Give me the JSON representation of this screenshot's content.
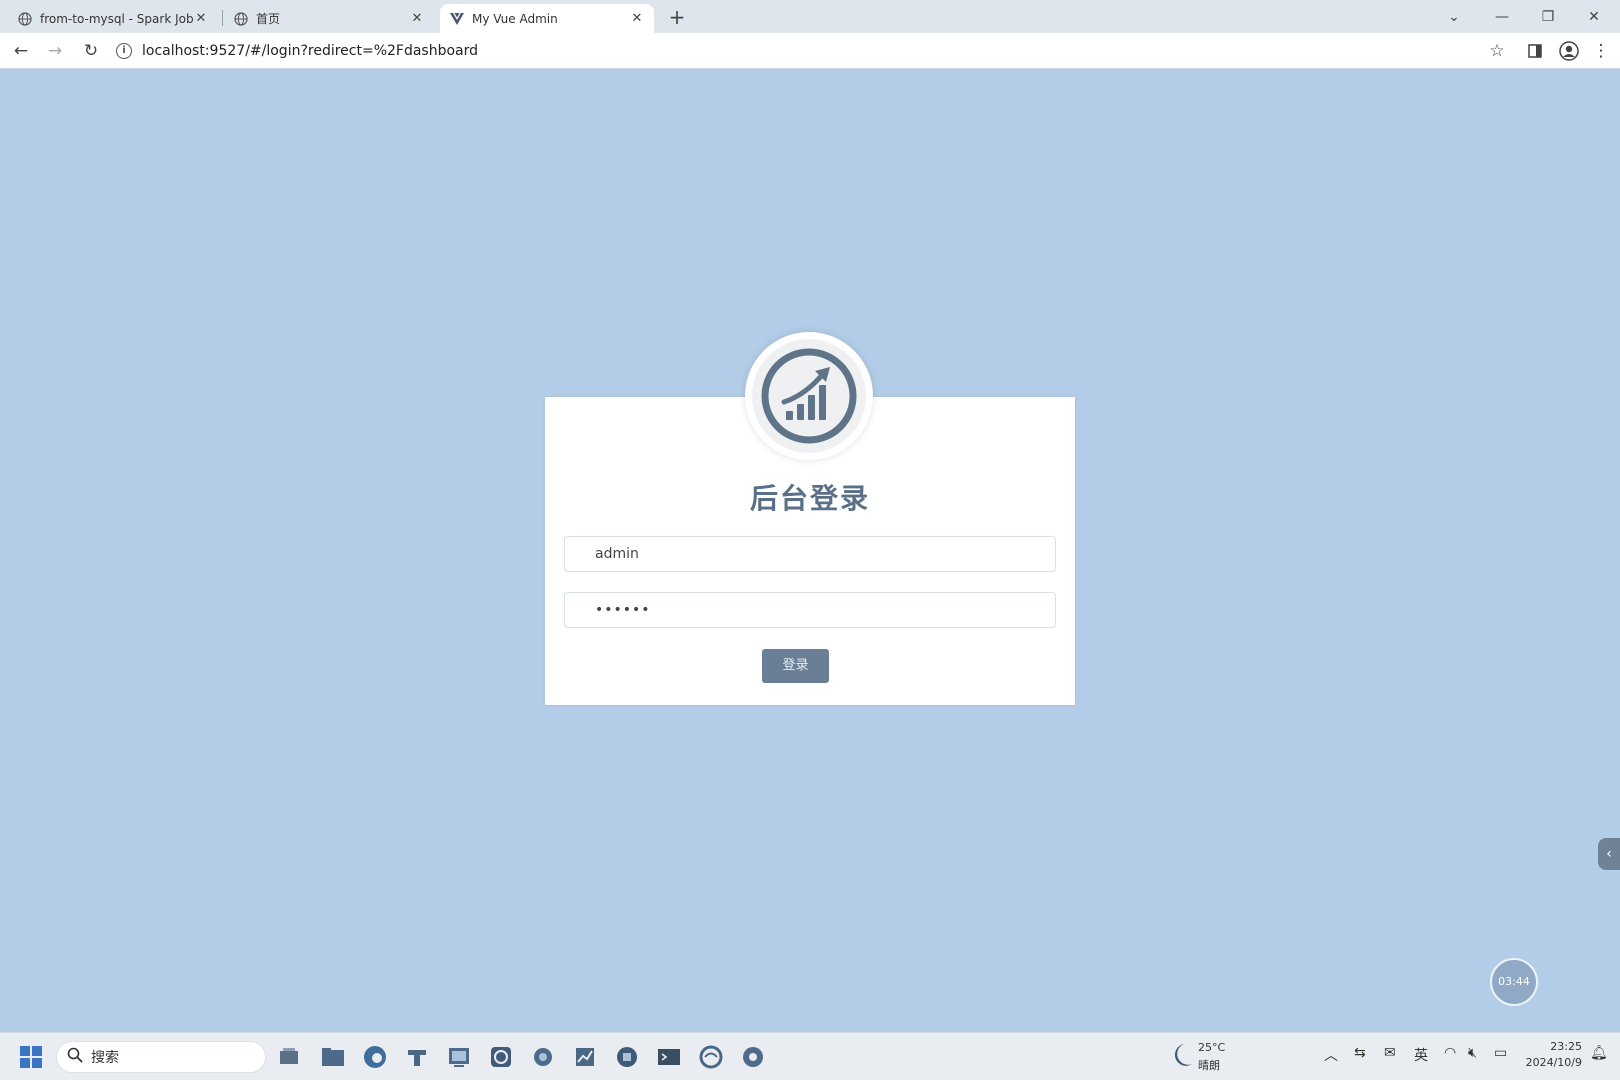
{
  "browser": {
    "tabs": [
      {
        "title": "from-to-mysql - Spark Jobs",
        "icon": "globe-icon",
        "active": false
      },
      {
        "title": "首页",
        "icon": "globe-icon",
        "active": false
      },
      {
        "title": "My Vue Admin",
        "icon": "vue-logo-icon",
        "active": true
      }
    ],
    "address": "localhost:9527/#/login?redirect=%2Fdashboard"
  },
  "login": {
    "title": "后台登录",
    "username_value": "admin",
    "password_value": "••••••",
    "submit_label": "登录",
    "logo_icon": "chart-growth-icon"
  },
  "float_clock": "03:44",
  "taskbar": {
    "search_label": "搜索",
    "weather": {
      "temp": "25°C",
      "condition": "晴朗"
    },
    "ime_label": "英",
    "time": "23:25",
    "date": "2024/10/9"
  },
  "colors": {
    "page_bg": "#b3cde8",
    "title": "#5a7087",
    "button": "#6a7f96",
    "logo": "#5f7489"
  }
}
